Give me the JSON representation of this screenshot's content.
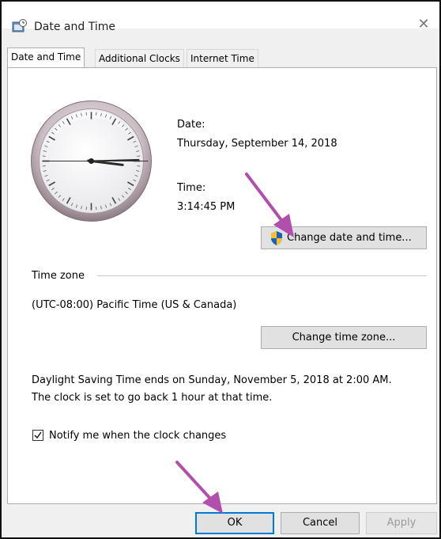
{
  "window": {
    "title": "Date and Time",
    "close_glyph": "✕"
  },
  "tabs": [
    {
      "label": "Date and Time",
      "active": true
    },
    {
      "label": "Additional Clocks",
      "active": false
    },
    {
      "label": "Internet Time",
      "active": false
    }
  ],
  "datetime": {
    "date_label": "Date:",
    "date_value": "Thursday, September 14, 2018",
    "time_label": "Time:",
    "time_value": "3:14:45 PM",
    "change_button": "Change date and time..."
  },
  "timezone": {
    "section_label": "Time zone",
    "value": "(UTC-08:00) Pacific Time (US & Canada)",
    "change_button": "Change time zone..."
  },
  "dst": {
    "line1": "Daylight Saving Time ends on Sunday, November 5, 2018 at 2:00 AM.",
    "line2": "The clock is set to go back 1 hour at that time."
  },
  "notify": {
    "label": "Notify me when the clock changes",
    "checked": true
  },
  "footer": {
    "ok": "OK",
    "cancel": "Cancel",
    "apply": "Apply"
  },
  "clock_time": {
    "hours": 3,
    "minutes": 14,
    "seconds": 45
  },
  "colors": {
    "annotation_arrow": "#b04fad",
    "accent": "#0078d7"
  },
  "icons": {
    "title": "date-time-app-icon",
    "uac": "uac-shield-icon",
    "check": "checkmark-icon"
  }
}
